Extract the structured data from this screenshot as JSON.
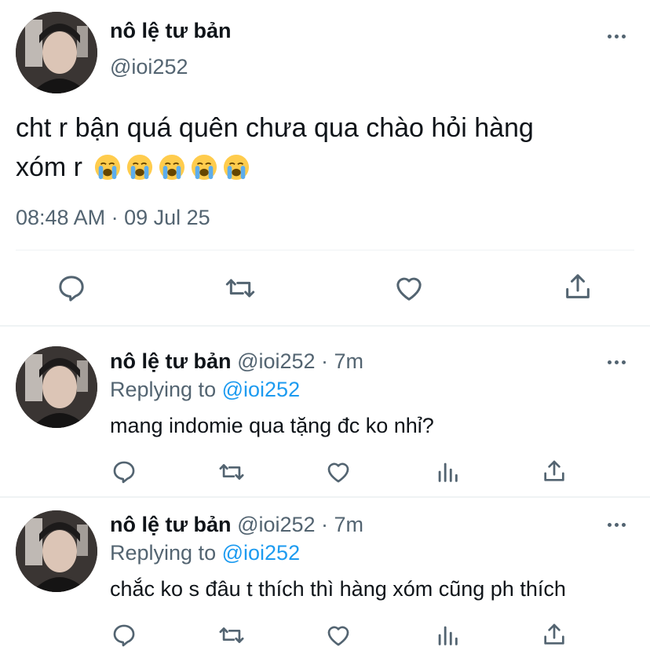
{
  "main_tweet": {
    "display_name": "nô lệ tư bản",
    "handle": "@ioi252",
    "text_line1": "cht r bận quá quên chưa qua chào hỏi hàng",
    "text_line2": "xóm r",
    "emojis": [
      "loudly-crying-face",
      "loudly-crying-face",
      "loudly-crying-face",
      "loudly-crying-face",
      "loudly-crying-face"
    ],
    "timestamp": "08:48 AM · 09 Jul 25"
  },
  "replies": [
    {
      "display_name": "nô lệ tư bản",
      "handle_time": "@ioi252 · 7m",
      "replying_label": "Replying to",
      "replying_to": "@ioi252",
      "text": "mang indomie qua tặng đc ko nhỉ?"
    },
    {
      "display_name": "nô lệ tư bản",
      "handle_time": "@ioi252 · 7m",
      "replying_label": "Replying to",
      "replying_to": "@ioi252",
      "text": "chắc ko s đâu t thích thì hàng xóm cũng ph thích"
    }
  ],
  "icons": [
    "more-icon",
    "reply-icon",
    "retweet-icon",
    "like-icon",
    "share-icon",
    "analytics-icon"
  ],
  "colors": {
    "text": "#0f1419",
    "gray": "#536471",
    "link": "#1d9bf0",
    "divider": "#eff3f4"
  }
}
